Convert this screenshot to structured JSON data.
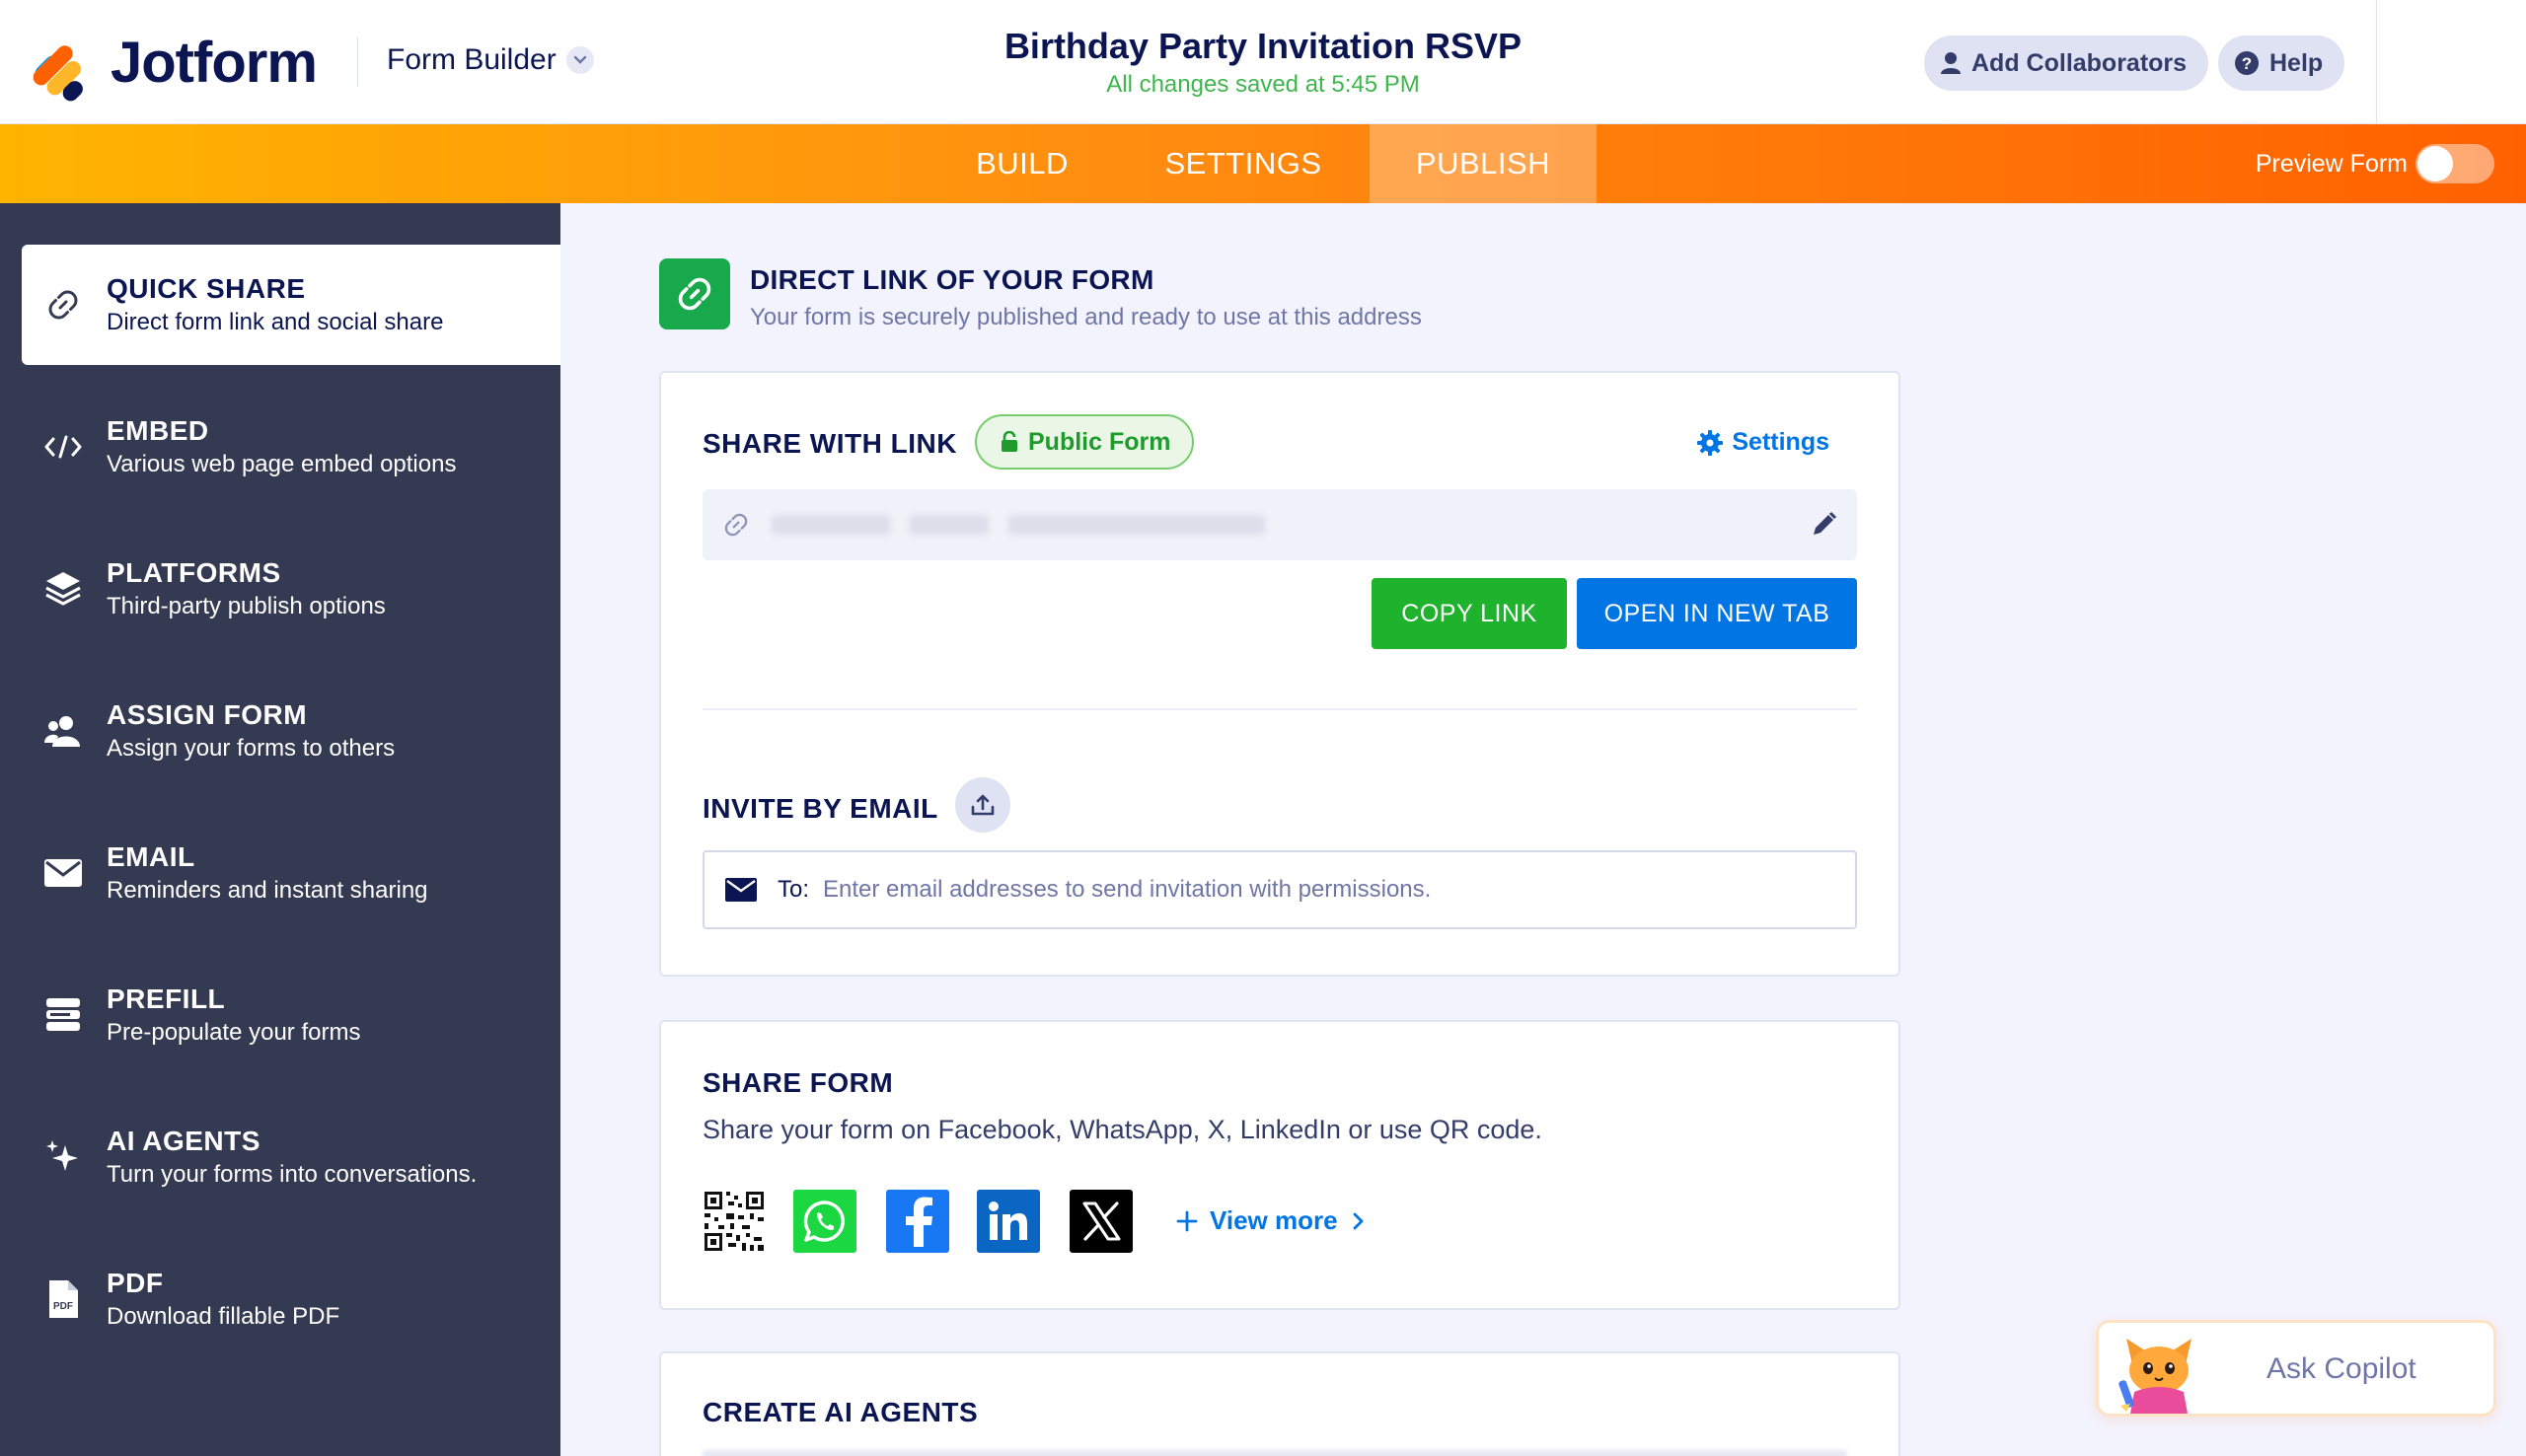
{
  "header": {
    "logo_text": "Jotform",
    "builder_label": "Form Builder",
    "form_title": "Birthday Party Invitation RSVP",
    "save_status": "All changes saved at 5:45 PM",
    "add_collaborators": "Add Collaborators",
    "help": "Help"
  },
  "nav": {
    "tabs": [
      "BUILD",
      "SETTINGS",
      "PUBLISH"
    ],
    "active_tab": "PUBLISH",
    "preview_label": "Preview Form",
    "preview_on": false
  },
  "sidebar": {
    "items": [
      {
        "title": "QUICK SHARE",
        "subtitle": "Direct form link and social share",
        "icon": "link-icon",
        "active": true
      },
      {
        "title": "EMBED",
        "subtitle": "Various web page embed options",
        "icon": "code-icon"
      },
      {
        "title": "PLATFORMS",
        "subtitle": "Third-party publish options",
        "icon": "layers-icon"
      },
      {
        "title": "ASSIGN FORM",
        "subtitle": "Assign your forms to others",
        "icon": "users-icon"
      },
      {
        "title": "EMAIL",
        "subtitle": "Reminders and instant sharing",
        "icon": "envelope-icon"
      },
      {
        "title": "PREFILL",
        "subtitle": "Pre-populate your forms",
        "icon": "prefill-icon"
      },
      {
        "title": "AI AGENTS",
        "subtitle": "Turn your forms into conversations.",
        "icon": "sparkle-icon"
      },
      {
        "title": "PDF",
        "subtitle": "Download fillable PDF",
        "icon": "pdf-icon"
      }
    ]
  },
  "direct_link": {
    "title": "DIRECT LINK OF YOUR FORM",
    "subtitle": "Your form is securely published and ready to use at this address"
  },
  "share_link": {
    "label": "SHARE WITH LINK",
    "badge": "Public Form",
    "settings": "Settings",
    "copy_link": "COPY LINK",
    "open_new_tab": "OPEN IN NEW TAB"
  },
  "invite": {
    "label": "INVITE BY EMAIL",
    "to_label": "To:",
    "placeholder": "Enter email addresses to send invitation with permissions."
  },
  "share_form": {
    "label": "SHARE FORM",
    "description": "Share your form on Facebook, WhatsApp, X, LinkedIn or use QR code.",
    "view_more": "View more",
    "icons": [
      "qr-code-icon",
      "whatsapp-icon",
      "facebook-icon",
      "linkedin-icon",
      "x-icon"
    ]
  },
  "ai_agents_card": {
    "label": "CREATE AI AGENTS"
  },
  "copilot": {
    "label": "Ask Copilot"
  },
  "colors": {
    "brand_navy": "#0a1551",
    "nav_gradient_start": "#ffb400",
    "nav_gradient_end": "#ff6100",
    "sidebar_bg": "#343a52",
    "green": "#1eb22d",
    "blue": "#0075e3"
  }
}
